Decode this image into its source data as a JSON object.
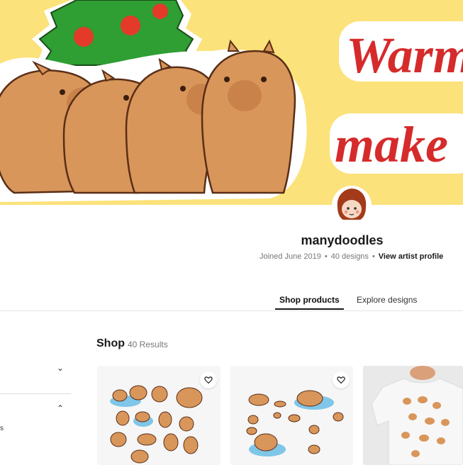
{
  "banner": {
    "headline_line1": "Warm",
    "headline_line2": "make"
  },
  "artist": {
    "name": "manydoodles",
    "joined": "Joined June 2019",
    "designs": "40 designs",
    "profile_link": "View artist profile"
  },
  "tabs": {
    "shop_products": "Shop products",
    "explore_designs": "Explore designs"
  },
  "shop": {
    "title": "Shop",
    "results": "40 Results"
  },
  "filters": {
    "partial_label": "s"
  },
  "colors": {
    "banner_bg": "#fbe27a",
    "headline_red": "#d62b2b",
    "tree_green": "#2f9e33",
    "capybara_brown": "#d9965a"
  }
}
